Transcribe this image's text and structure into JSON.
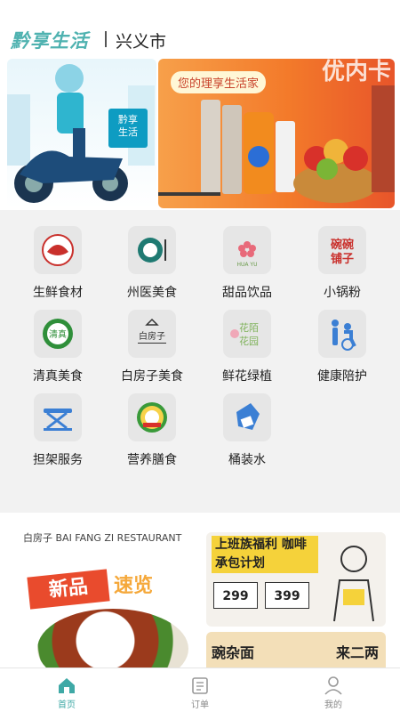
{
  "header": {
    "brand": "黔享生活",
    "city": "兴义市"
  },
  "banners": {
    "right_slogan": "您的理享生活家",
    "right_title": "优内卡",
    "left_tag": "黔享\n生活"
  },
  "categories": [
    {
      "label": "生鲜食材",
      "icon": "fresh-food-icon"
    },
    {
      "label": "州医美食",
      "icon": "hospital-food-icon"
    },
    {
      "label": "甜品饮品",
      "icon": "dessert-icon"
    },
    {
      "label": "小锅粉",
      "icon": "noodle-bowl-icon"
    },
    {
      "label": "清真美食",
      "icon": "halal-icon"
    },
    {
      "label": "白房子美食",
      "icon": "white-house-icon"
    },
    {
      "label": "鲜花绿植",
      "icon": "flower-icon"
    },
    {
      "label": "健康陪护",
      "icon": "caregiver-icon"
    },
    {
      "label": "担架服务",
      "icon": "stretcher-icon"
    },
    {
      "label": "营养膳食",
      "icon": "nutrition-icon"
    },
    {
      "label": "桶装水",
      "icon": "water-bottle-icon"
    }
  ],
  "promos": {
    "left_logo": "白房子 BAI FANG ZI RESTAURANT",
    "left_new": "新品",
    "left_speed": "速览",
    "right1_title": "上班族福利 咖啡承包计划",
    "right1_prices": [
      "299",
      "399"
    ],
    "right2_left": "豌杂面",
    "right2_right": "来二两"
  },
  "tabbar": [
    {
      "label": "首页",
      "icon": "home-icon",
      "active": true
    },
    {
      "label": "订单",
      "icon": "order-icon",
      "active": false
    },
    {
      "label": "我的",
      "icon": "profile-icon",
      "active": false
    }
  ],
  "colors": {
    "accent": "#3fa9a6",
    "brand": "#4fb2b0",
    "background": "#f2f2f2"
  }
}
